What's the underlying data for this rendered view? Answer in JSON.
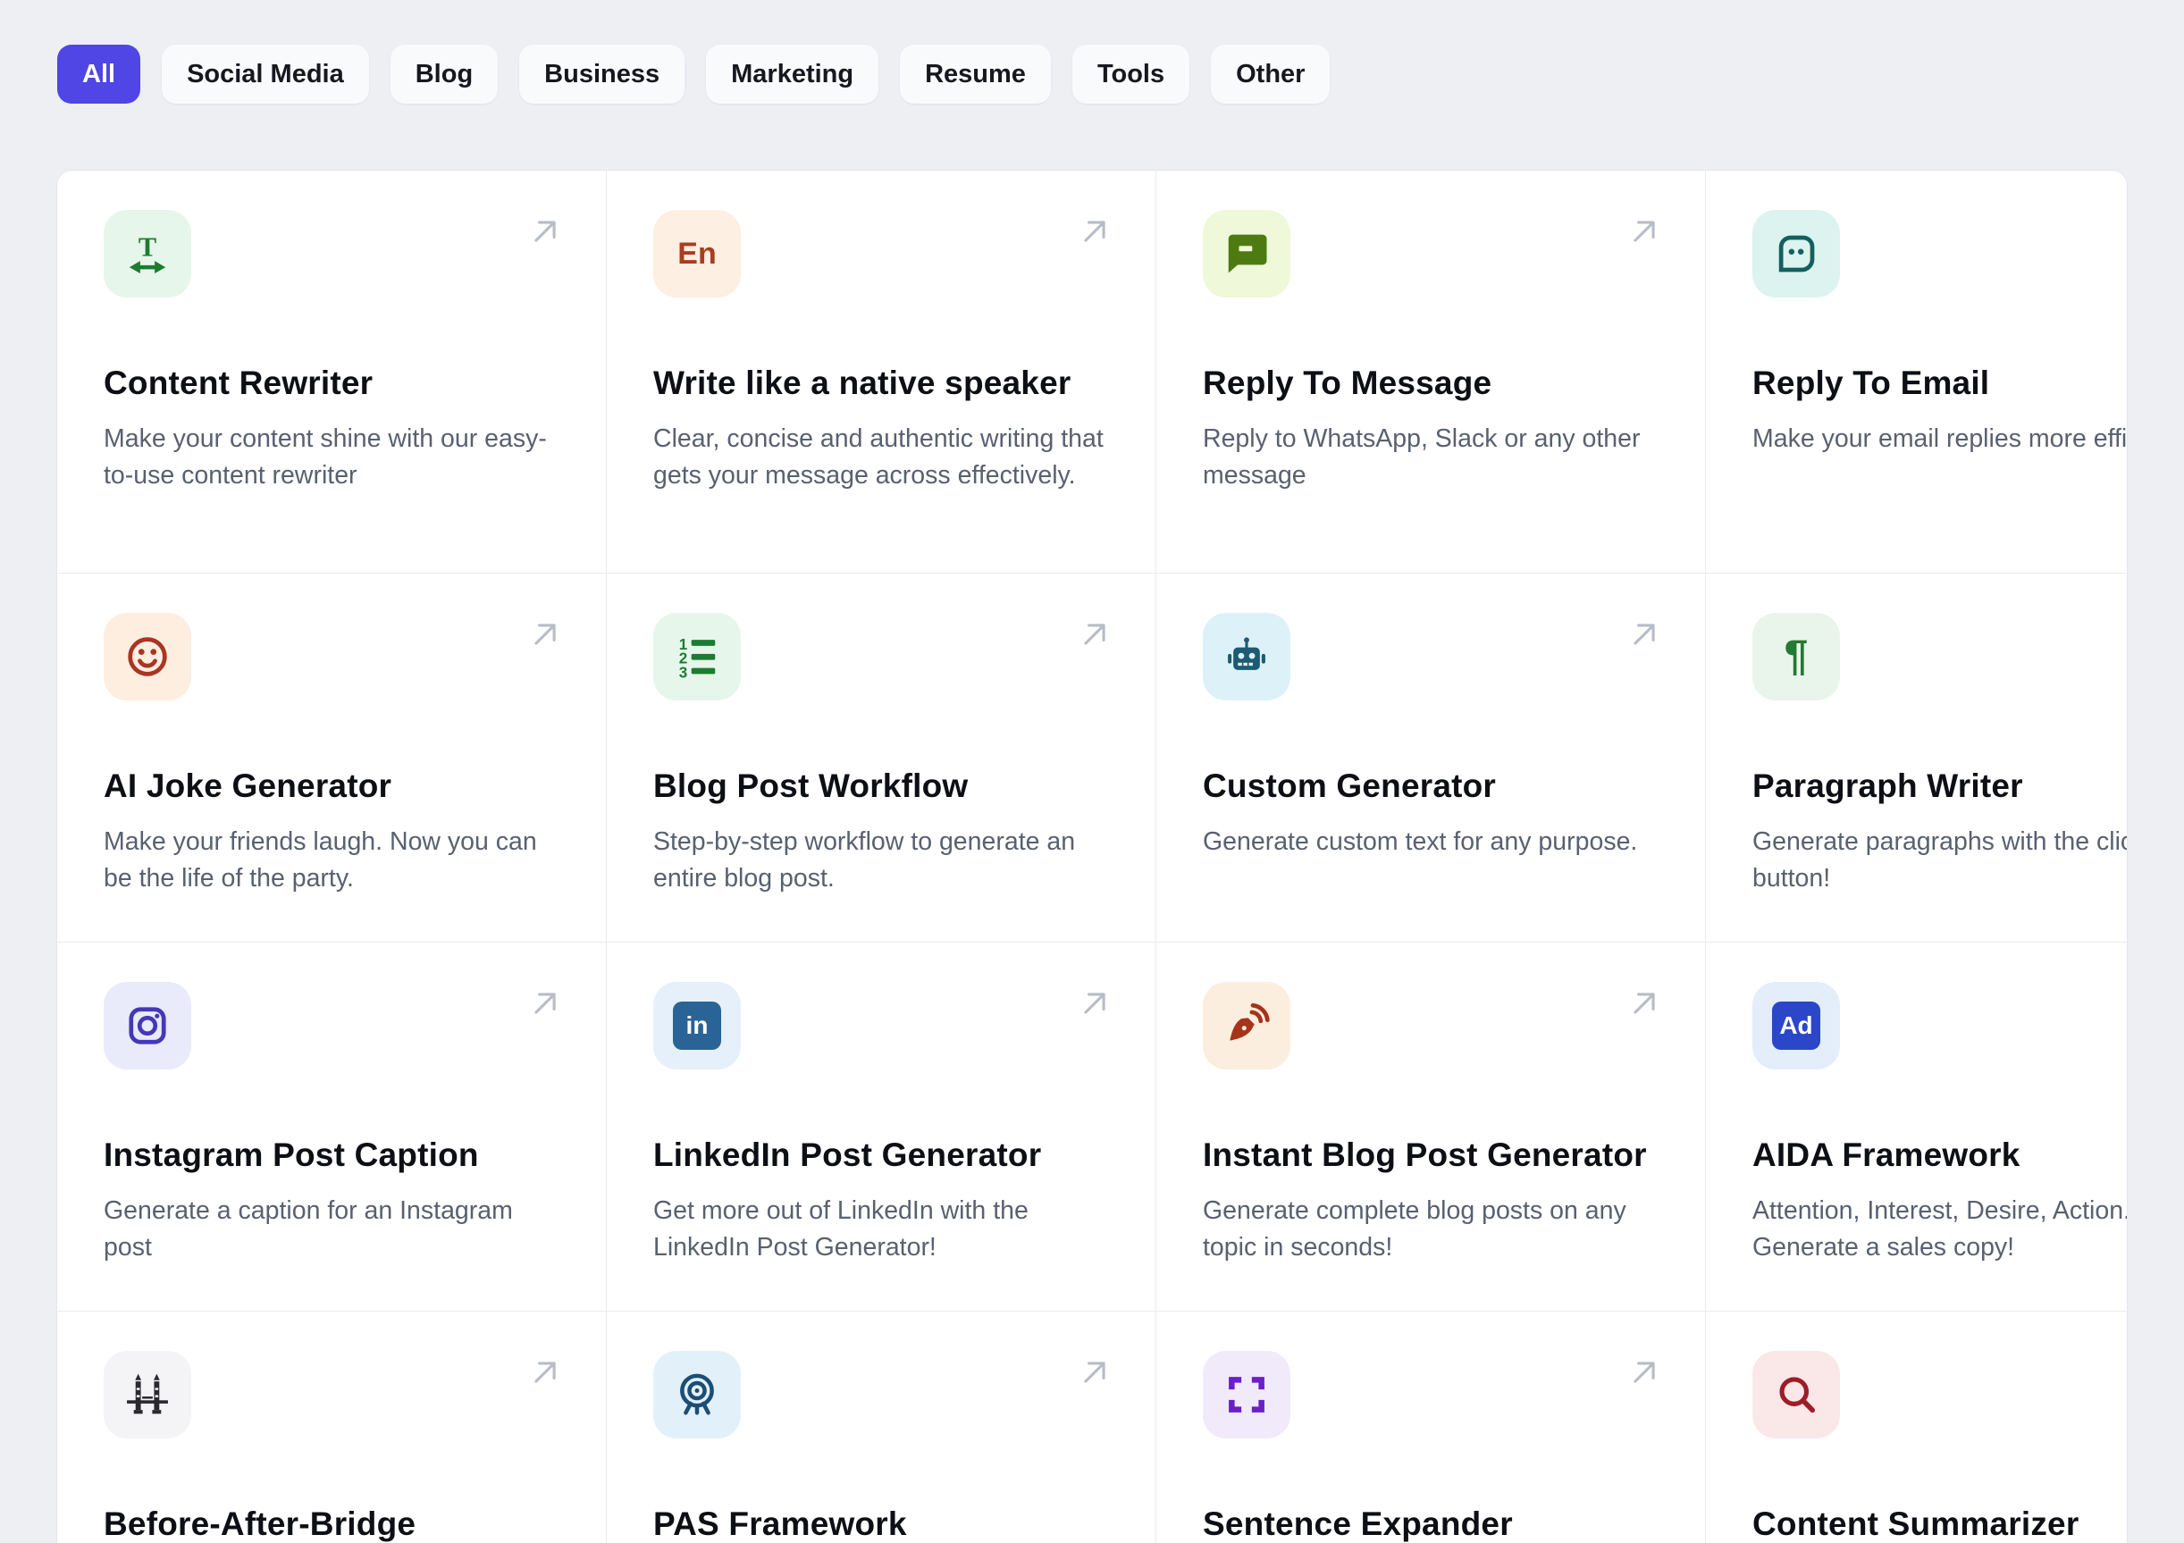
{
  "ui": {
    "arrow_icon": "arrow-up-right-icon",
    "arrow_color": "#b7bcc6",
    "page_background": "#edeff3"
  },
  "filters": {
    "active_bg": "#4f46e5",
    "items": [
      {
        "label": "All",
        "active": true
      },
      {
        "label": "Social Media",
        "active": false
      },
      {
        "label": "Blog",
        "active": false
      },
      {
        "label": "Business",
        "active": false
      },
      {
        "label": "Marketing",
        "active": false
      },
      {
        "label": "Resume",
        "active": false
      },
      {
        "label": "Tools",
        "active": false
      },
      {
        "label": "Other",
        "active": false
      }
    ]
  },
  "cards": [
    {
      "title": "Content Rewriter",
      "description": "Make your content shine with our easy-to-use content rewriter",
      "icon": "text-width-icon",
      "icon_bg": "#e7f6ea",
      "icon_color": "#1c7c31"
    },
    {
      "title": "Write like a native speaker",
      "description": "Clear, concise and authentic writing that gets your message across effectively.",
      "icon": "language-en-icon",
      "icon_text": "En",
      "icon_bg": "#fdefe1",
      "icon_color": "#a83d1f"
    },
    {
      "title": "Reply To Message",
      "description": "Reply to WhatsApp, Slack or any other message",
      "icon": "chat-bubble-icon",
      "icon_bg": "#eff8d8",
      "icon_color": "#4d7b11"
    },
    {
      "title": "Reply To Email",
      "description": "Make your email replies more efficient",
      "icon": "chat-face-icon",
      "icon_bg": "#dcf3ef",
      "icon_color": "#14605e"
    },
    {
      "title": "AI Joke Generator",
      "description": "Make your friends laugh. Now you can be the life of the party.",
      "icon": "smiley-icon",
      "icon_bg": "#fdeee0",
      "icon_color": "#a93523"
    },
    {
      "title": "Blog Post Workflow",
      "description": "Step-by-step workflow to generate an entire blog post.",
      "icon": "numbered-list-icon",
      "icon_bg": "#e7f6ea",
      "icon_color": "#1c7c31"
    },
    {
      "title": "Custom Generator",
      "description": "Generate custom text for any purpose.",
      "icon": "robot-icon",
      "icon_bg": "#dcf2f8",
      "icon_color": "#1d5b73"
    },
    {
      "title": "Paragraph Writer",
      "description": "Generate paragraphs with the click of a button!",
      "icon": "pilcrow-icon",
      "icon_text": "¶",
      "icon_bg": "#e9f5eb",
      "icon_color": "#237a31"
    },
    {
      "title": "Instagram Post Caption",
      "description": "Generate a caption for an Instagram post",
      "icon": "instagram-icon",
      "icon_bg": "#e9eafa",
      "icon_color": "#4438b8"
    },
    {
      "title": "LinkedIn Post Generator",
      "description": "Get more out of LinkedIn with the LinkedIn Post Generator!",
      "icon": "linkedin-icon",
      "icon_text": "in",
      "icon_bg": "#e6f0fa",
      "icon_color": "#2a6496"
    },
    {
      "title": "Instant Blog Post Generator",
      "description": "Generate complete blog posts on any topic in seconds!",
      "icon": "pen-nib-signal-icon",
      "icon_bg": "#fceede",
      "icon_color": "#a5341b"
    },
    {
      "title": "AIDA Framework",
      "description": "Attention, Interest, Desire, Action. Generate a sales copy!",
      "icon": "ad-badge-icon",
      "icon_text": "Ad",
      "icon_bg": "#e4edfa",
      "icon_color": "#2b46c9"
    },
    {
      "title": "Before-After-Bridge",
      "icon": "bridge-icon",
      "icon_bg": "#f4f4f6",
      "icon_color": "#2a2a2e"
    },
    {
      "title": "PAS Framework",
      "icon": "target-tripod-icon",
      "icon_bg": "#e2f0f9",
      "icon_color": "#1c4d73"
    },
    {
      "title": "Sentence Expander",
      "icon": "expand-corners-icon",
      "icon_bg": "#f0eafa",
      "icon_color": "#6b1fc8"
    },
    {
      "title": "Content Summarizer",
      "icon": "magnifier-icon",
      "icon_bg": "#fae8e8",
      "icon_color": "#9e1c28"
    }
  ]
}
